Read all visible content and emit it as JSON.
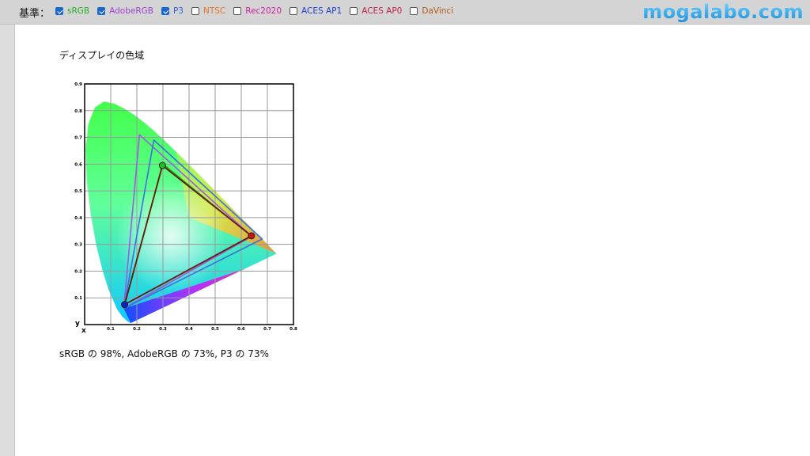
{
  "toolbar": {
    "basis_label": "基準：",
    "options": [
      {
        "label": "sRGB",
        "checked": true,
        "color": "#22b022"
      },
      {
        "label": "AdobeRGB",
        "checked": true,
        "color": "#a040d0"
      },
      {
        "label": "P3",
        "checked": true,
        "color": "#2a63d8"
      },
      {
        "label": "NTSC",
        "checked": false,
        "color": "#e8742c"
      },
      {
        "label": "Rec2020",
        "checked": false,
        "color": "#d020a8"
      },
      {
        "label": "ACES AP1",
        "checked": false,
        "color": "#1a3fd0"
      },
      {
        "label": "ACES AP0",
        "checked": false,
        "color": "#c02048"
      },
      {
        "label": "DaVinci",
        "checked": false,
        "color": "#b25a16"
      }
    ]
  },
  "logo": "mogalabo.com",
  "page": {
    "heading": "ディスプレイの色域",
    "summary": "sRGB の 98%, AdobeRGB の 73%, P3 の 73%"
  },
  "chart_data": {
    "type": "scatter",
    "xlabel": "x",
    "ylabel": "y",
    "xlim": [
      0,
      0.8
    ],
    "ylim": [
      0,
      0.9
    ],
    "x_ticks": [
      "0.1",
      "0.2",
      "0.3",
      "0.4",
      "0.5",
      "0.6",
      "0.7",
      "0.8"
    ],
    "y_ticks": [
      "0.1",
      "0.2",
      "0.3",
      "0.4",
      "0.5",
      "0.6",
      "0.7",
      "0.8",
      "0.9"
    ],
    "grid": true,
    "series": [
      {
        "name": "sRGB",
        "color": "#22a022",
        "points": [
          [
            0.64,
            0.33
          ],
          [
            0.3,
            0.6
          ],
          [
            0.15,
            0.06
          ]
        ]
      },
      {
        "name": "AdobeRGB",
        "color": "#9b5ce0",
        "points": [
          [
            0.64,
            0.33
          ],
          [
            0.21,
            0.71
          ],
          [
            0.15,
            0.06
          ]
        ]
      },
      {
        "name": "P3",
        "color": "#3d6fe0",
        "points": [
          [
            0.68,
            0.32
          ],
          [
            0.265,
            0.69
          ],
          [
            0.15,
            0.06
          ]
        ]
      },
      {
        "name": "",
        "color": "#6b1a10",
        "points": [
          [
            0.639,
            0.332
          ],
          [
            0.298,
            0.595
          ],
          [
            0.153,
            0.075
          ]
        ]
      }
    ]
  }
}
